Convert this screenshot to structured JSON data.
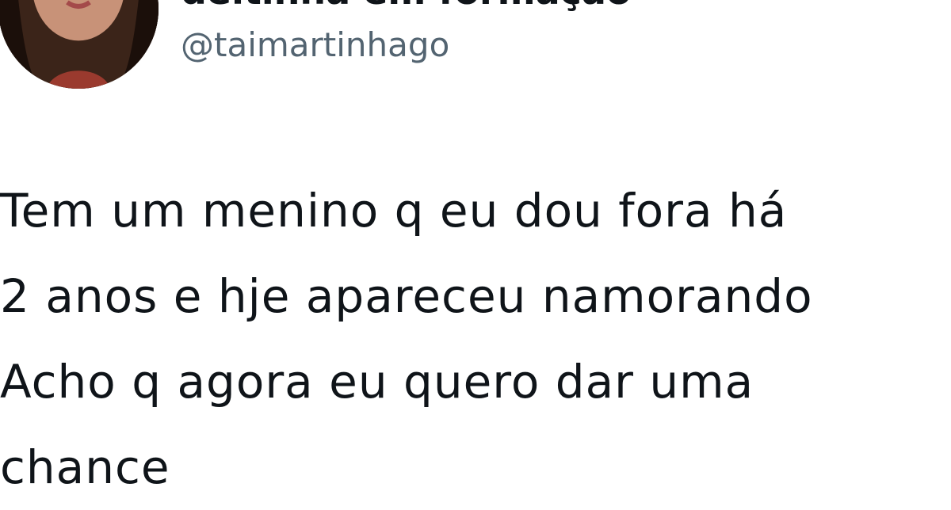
{
  "tweet": {
    "author": {
      "display_name": "deltinha em formação",
      "handle": "@taimartinhago"
    },
    "text_lines": [
      "Tem um menino q eu dou fora há",
      "2 anos e hje apareceu namorando",
      "Acho q agora eu quero dar uma",
      "chance"
    ]
  },
  "colors": {
    "text": "#0f1419",
    "handle": "#536471",
    "background": "#ffffff"
  }
}
